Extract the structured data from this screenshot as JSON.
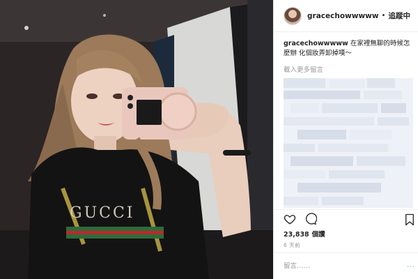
{
  "post": {
    "photo_alt_icon": "selfie-photo",
    "header": {
      "username": "gracechowwwww",
      "separator": "•",
      "follow_label": "追蹤中"
    },
    "caption": {
      "username": "gracechowwwww",
      "text": "在家裡無聊的時候怎麼辦 化個妝弄卸掉嘆～"
    },
    "more_comments": "載入更多留言",
    "actions": {
      "like_icon": "heart-icon",
      "comment_icon": "comment-icon",
      "bookmark_icon": "bookmark-icon"
    },
    "likes": {
      "count": "23,838",
      "label": "個讚"
    },
    "time_ago": "6 天前",
    "comment_box": {
      "placeholder": "留言……",
      "post_label": "..."
    }
  },
  "colors": {
    "border": "#efefef",
    "muted_text": "#999999",
    "pixelation": "#dfe5ef"
  }
}
